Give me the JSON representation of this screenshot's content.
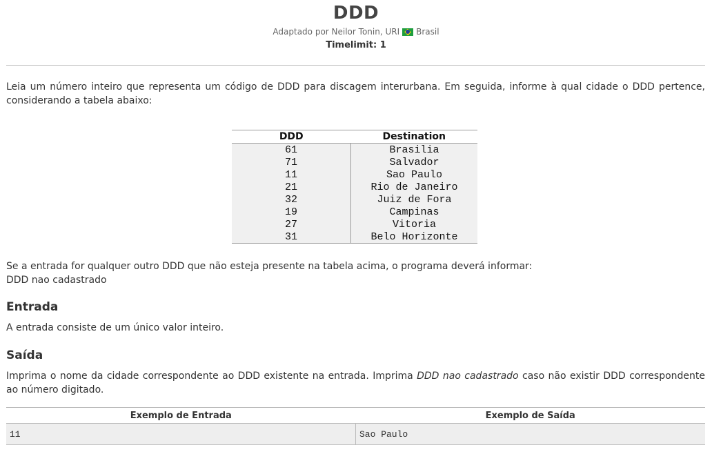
{
  "problem": {
    "title": "DDD",
    "author": "Adaptado por Neilor Tonin, URI",
    "country": "Brasil",
    "country_flag_icon": "brazil-flag-icon",
    "timelimit": "Timelimit: 1"
  },
  "description": {
    "intro": "Leia um número inteiro que representa um código de DDD para discagem interurbana. Em seguida, informe à qual cidade o DDD pertence, considerando a tabela abaixo:",
    "note_line1": "Se a entrada for qualquer outro DDD que não esteja presente na tabela acima, o programa deverá informar:",
    "note_line2": "DDD nao cadastrado"
  },
  "ddd_table": {
    "headers": [
      "DDD",
      "Destination"
    ],
    "rows": [
      [
        "61",
        "Brasilia"
      ],
      [
        "71",
        "Salvador"
      ],
      [
        "11",
        "Sao Paulo"
      ],
      [
        "21",
        "Rio de Janeiro"
      ],
      [
        "32",
        "Juiz de Fora"
      ],
      [
        "19",
        "Campinas"
      ],
      [
        "27",
        "Vitoria"
      ],
      [
        "31",
        "Belo Horizonte"
      ]
    ]
  },
  "input_section": {
    "heading": "Entrada",
    "text": "A entrada consiste de um único valor inteiro."
  },
  "output_section": {
    "heading": "Saída",
    "text_before": "Imprima o nome da cidade correspondente ao DDD existente na entrada. Imprima ",
    "text_em": "DDD nao cadastrado",
    "text_after": " caso não existir DDD correspondente ao número digitado."
  },
  "examples": {
    "input_header": "Exemplo de Entrada",
    "output_header": "Exemplo de Saída",
    "input_value": "11",
    "output_value": "Sao Paulo"
  }
}
